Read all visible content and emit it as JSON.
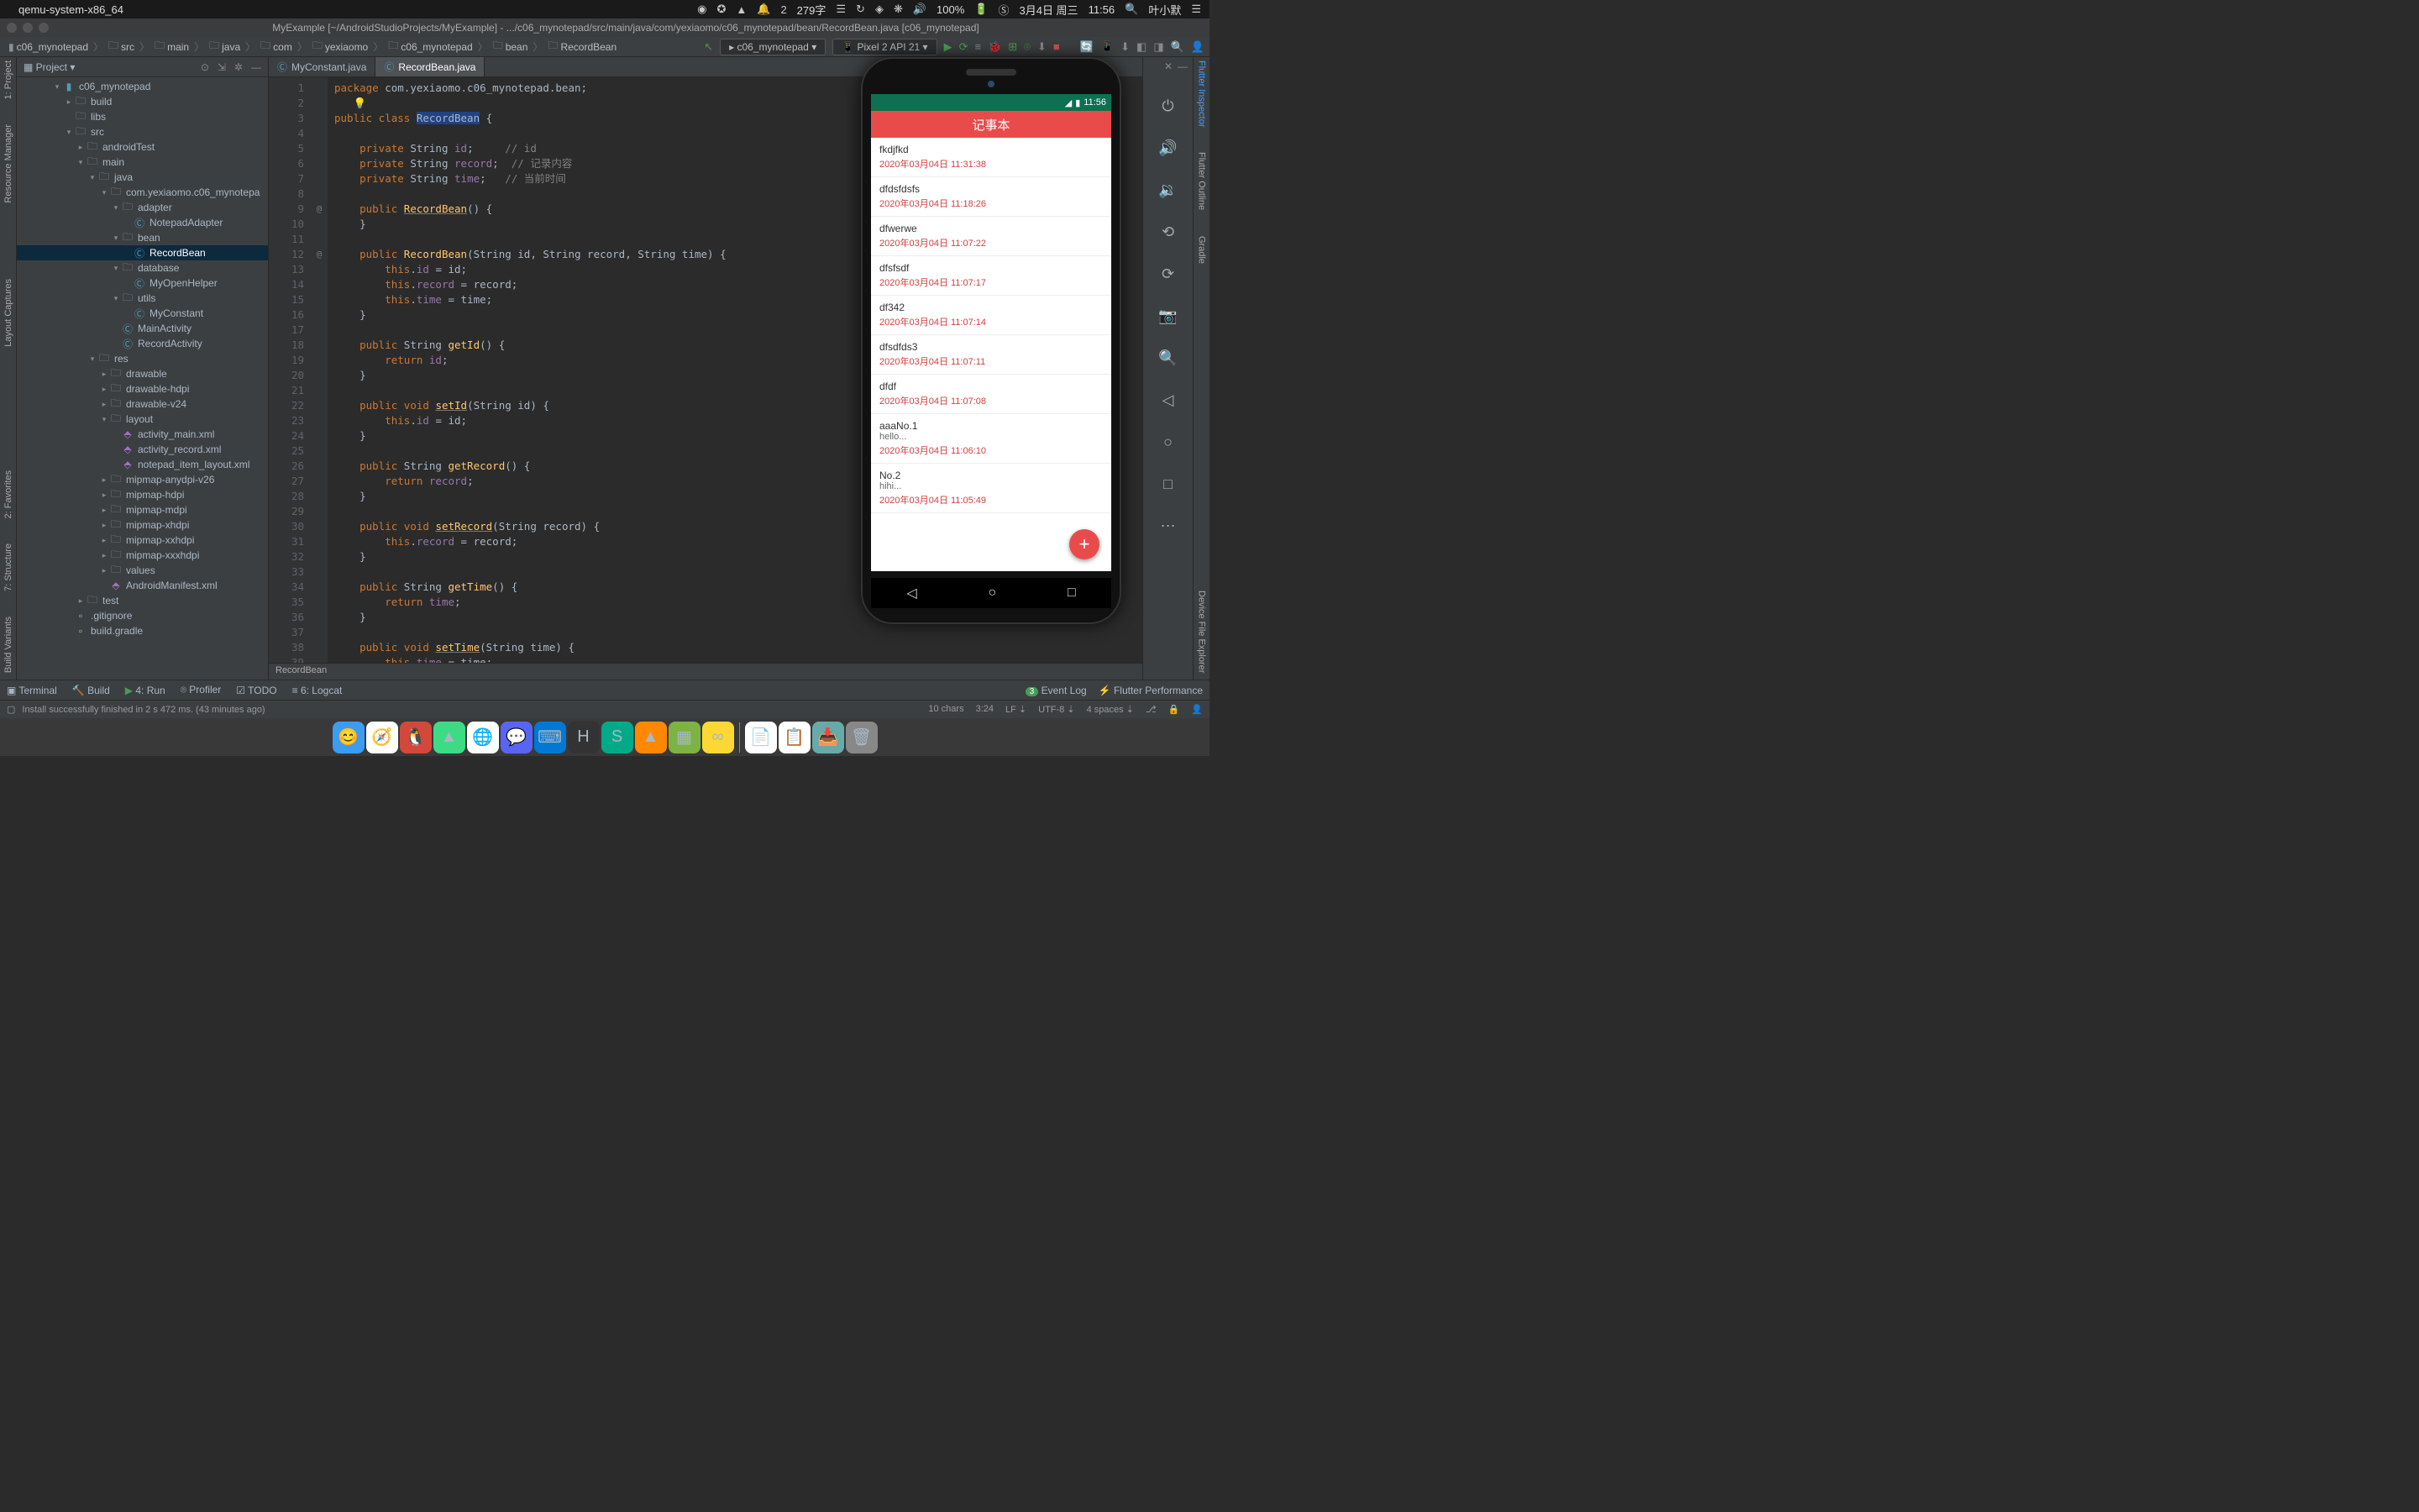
{
  "macos": {
    "app_name": "qemu-system-x86_64",
    "input_stat": "279字",
    "battery": "100%",
    "date": "3月4日 周三",
    "time": "11:56",
    "user": "叶小默"
  },
  "window": {
    "title": "MyExample [~/AndroidStudioProjects/MyExample] - .../c06_mynotepad/src/main/java/com/yexiaomo/c06_mynotepad/bean/RecordBean.java [c06_mynotepad]"
  },
  "breadcrumb": [
    "c06_mynotepad",
    "src",
    "main",
    "java",
    "com",
    "yexiaomo",
    "c06_mynotepad",
    "bean",
    "RecordBean"
  ],
  "run_config": "c06_mynotepad",
  "device": "Pixel 2 API 21",
  "left_strips": [
    "1: Project",
    "Resource Manager",
    "Layout Captures",
    "2: Favorites",
    "7: Structure",
    "Build Variants"
  ],
  "right_strips": [
    "Flutter Inspector",
    "Flutter Outline",
    "Gradle",
    "Device File Explorer"
  ],
  "project": {
    "header": "Project",
    "tree": [
      {
        "d": 3,
        "a": "▾",
        "ic": "mod",
        "t": "c06_mynotepad"
      },
      {
        "d": 4,
        "a": "▸",
        "ic": "dir",
        "t": "build"
      },
      {
        "d": 4,
        "a": "",
        "ic": "dir",
        "t": "libs"
      },
      {
        "d": 4,
        "a": "▾",
        "ic": "dir",
        "t": "src"
      },
      {
        "d": 5,
        "a": "▸",
        "ic": "dir",
        "t": "androidTest"
      },
      {
        "d": 5,
        "a": "▾",
        "ic": "dir",
        "t": "main"
      },
      {
        "d": 6,
        "a": "▾",
        "ic": "dir",
        "t": "java"
      },
      {
        "d": 7,
        "a": "▾",
        "ic": "dir",
        "t": "com.yexiaomo.c06_mynotepa"
      },
      {
        "d": 8,
        "a": "▾",
        "ic": "dir",
        "t": "adapter"
      },
      {
        "d": 9,
        "a": "",
        "ic": "class",
        "t": "NotepadAdapter"
      },
      {
        "d": 8,
        "a": "▾",
        "ic": "dir",
        "t": "bean"
      },
      {
        "d": 9,
        "a": "",
        "ic": "class",
        "t": "RecordBean",
        "sel": true
      },
      {
        "d": 8,
        "a": "▾",
        "ic": "dir",
        "t": "database"
      },
      {
        "d": 9,
        "a": "",
        "ic": "class",
        "t": "MyOpenHelper"
      },
      {
        "d": 8,
        "a": "▾",
        "ic": "dir",
        "t": "utils"
      },
      {
        "d": 9,
        "a": "",
        "ic": "class",
        "t": "MyConstant"
      },
      {
        "d": 8,
        "a": "",
        "ic": "class",
        "t": "MainActivity"
      },
      {
        "d": 8,
        "a": "",
        "ic": "class",
        "t": "RecordActivity"
      },
      {
        "d": 6,
        "a": "▾",
        "ic": "dir",
        "t": "res"
      },
      {
        "d": 7,
        "a": "▸",
        "ic": "dir",
        "t": "drawable"
      },
      {
        "d": 7,
        "a": "▸",
        "ic": "dir",
        "t": "drawable-hdpi"
      },
      {
        "d": 7,
        "a": "▸",
        "ic": "dir",
        "t": "drawable-v24"
      },
      {
        "d": 7,
        "a": "▾",
        "ic": "dir",
        "t": "layout"
      },
      {
        "d": 8,
        "a": "",
        "ic": "xml",
        "t": "activity_main.xml"
      },
      {
        "d": 8,
        "a": "",
        "ic": "xml",
        "t": "activity_record.xml"
      },
      {
        "d": 8,
        "a": "",
        "ic": "xml",
        "t": "notepad_item_layout.xml"
      },
      {
        "d": 7,
        "a": "▸",
        "ic": "dir",
        "t": "mipmap-anydpi-v26"
      },
      {
        "d": 7,
        "a": "▸",
        "ic": "dir",
        "t": "mipmap-hdpi"
      },
      {
        "d": 7,
        "a": "▸",
        "ic": "dir",
        "t": "mipmap-mdpi"
      },
      {
        "d": 7,
        "a": "▸",
        "ic": "dir",
        "t": "mipmap-xhdpi"
      },
      {
        "d": 7,
        "a": "▸",
        "ic": "dir",
        "t": "mipmap-xxhdpi"
      },
      {
        "d": 7,
        "a": "▸",
        "ic": "dir",
        "t": "mipmap-xxxhdpi"
      },
      {
        "d": 7,
        "a": "▸",
        "ic": "dir",
        "t": "values"
      },
      {
        "d": 7,
        "a": "",
        "ic": "xml",
        "t": "AndroidManifest.xml"
      },
      {
        "d": 5,
        "a": "▸",
        "ic": "dir",
        "t": "test"
      },
      {
        "d": 4,
        "a": "",
        "ic": "file",
        "t": ".gitignore"
      },
      {
        "d": 4,
        "a": "",
        "ic": "file",
        "t": "build.gradle"
      }
    ]
  },
  "tabs": [
    {
      "label": "MyConstant.java",
      "active": false
    },
    {
      "label": "RecordBean.java",
      "active": true
    }
  ],
  "code": {
    "package": "package com.yexiaomo.c06_mynotepad.bean;",
    "class_name": "RecordBean",
    "field_id_comment": "// id",
    "field_record_comment": "// 记录内容",
    "field_time_comment": "// 当前时间",
    "breadcrumb": "RecordBean"
  },
  "gutter_marks": {
    "9": "@",
    "12": "@"
  },
  "emulator": {
    "status_time": "11:56",
    "app_title": "记事本",
    "notes": [
      {
        "title": "fkdjfkd",
        "time": "2020年03月04日 11:31:38"
      },
      {
        "title": "dfdsfdsfs",
        "time": "2020年03月04日 11:18:26"
      },
      {
        "title": "dfwerwe",
        "time": "2020年03月04日 11:07:22"
      },
      {
        "title": "dfsfsdf",
        "time": "2020年03月04日 11:07:17"
      },
      {
        "title": "df342",
        "time": "2020年03月04日 11:07:14"
      },
      {
        "title": "dfsdfds3",
        "time": "2020年03月04日 11:07:11"
      },
      {
        "title": "dfdf",
        "time": "2020年03月04日 11:07:08"
      },
      {
        "title": "aaaNo.1",
        "sub": "hello...",
        "time": "2020年03月04日 11:06:10"
      },
      {
        "title": "No.2",
        "sub": "hihi...",
        "time": "2020年03月04日 11:05:49"
      }
    ]
  },
  "bottom_tools": {
    "terminal": "Terminal",
    "build": "Build",
    "run": "4: Run",
    "profiler": "Profiler",
    "todo": "TODO",
    "logcat": "6: Logcat",
    "event_log": "Event Log",
    "event_badge": "3",
    "flutter_perf": "Flutter Performance"
  },
  "status": {
    "message": "Install successfully finished in 2 s 472 ms. (43 minutes ago)",
    "chars": "10 chars",
    "pos": "3:24",
    "le": "LF",
    "enc": "UTF-8",
    "indent": "4 spaces"
  }
}
